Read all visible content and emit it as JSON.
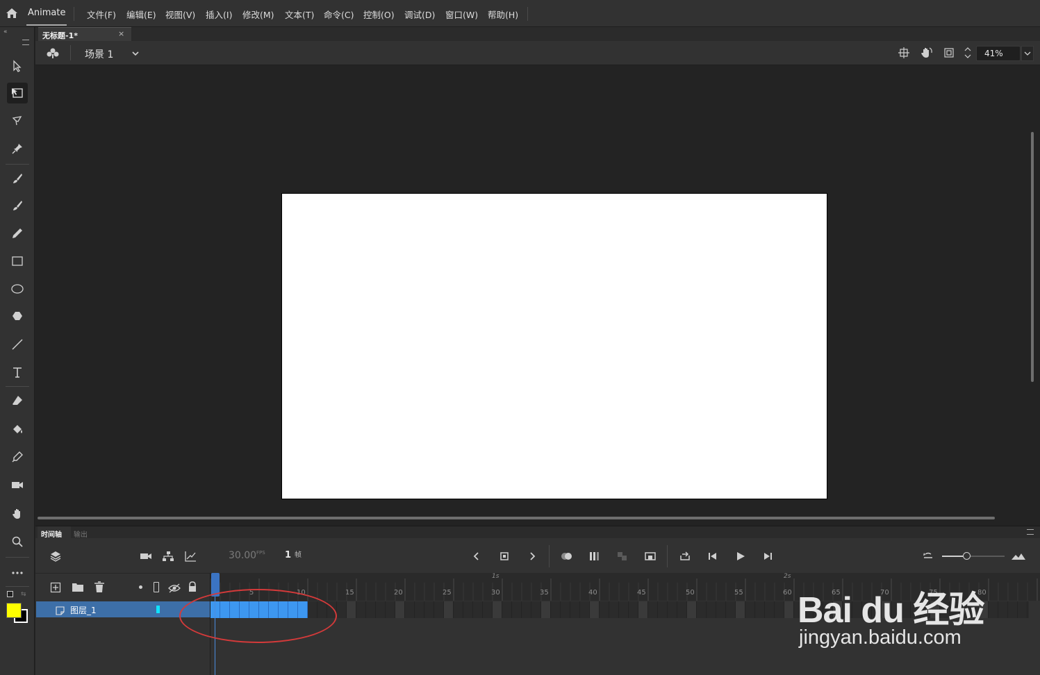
{
  "app": {
    "name": "Animate"
  },
  "menu": [
    "文件(F)",
    "编辑(E)",
    "视图(V)",
    "插入(I)",
    "修改(M)",
    "文本(T)",
    "命令(C)",
    "控制(O)",
    "调试(D)",
    "窗口(W)",
    "帮助(H)"
  ],
  "document": {
    "tab_title": "无标题-1*",
    "close": "×"
  },
  "editbar": {
    "scene": "场景 1",
    "zoom": "41%"
  },
  "colors": {
    "fill": "#ffff00",
    "stroke": "#000000",
    "stage": "#ffffff",
    "layer_color": "#10e2ff",
    "frames": "#3d97f0",
    "annotation": "#d43a3a"
  },
  "timeline": {
    "tabs": [
      "时间轴",
      "输出"
    ],
    "fps": "30.00",
    "fps_unit": "FPS",
    "current_frame": "1",
    "frame_unit": "帧",
    "layer": {
      "name": "图层_1"
    },
    "ruler_numbers": [
      "5",
      "10",
      "15",
      "20",
      "25",
      "30",
      "35",
      "40",
      "45",
      "50",
      "55",
      "60",
      "65",
      "70",
      "75",
      "80"
    ],
    "ruler_seconds": [
      "1s",
      "2s"
    ],
    "filled_frames": 10
  },
  "watermark": {
    "brand": "Bai du 经验",
    "url": "jingyan.baidu.com"
  }
}
